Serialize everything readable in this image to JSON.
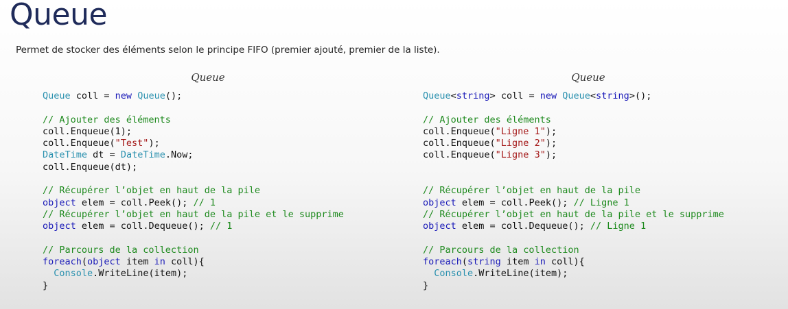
{
  "slide": {
    "title": "Queue",
    "description": "Permet de stocker des éléments selon le principe FIFO (premier ajouté, premier de la liste)."
  },
  "left_column": {
    "heading": "Queue",
    "lines": [
      [
        {
          "t": "ty",
          "v": "Queue"
        },
        {
          "t": "pl",
          "v": " coll = "
        },
        {
          "t": "kw",
          "v": "new"
        },
        {
          "t": "pl",
          "v": " "
        },
        {
          "t": "ty",
          "v": "Queue"
        },
        {
          "t": "pl",
          "v": "();"
        }
      ],
      [],
      [
        {
          "t": "cm",
          "v": "// Ajouter des éléments"
        }
      ],
      [
        {
          "t": "pl",
          "v": "coll.Enqueue(1);"
        }
      ],
      [
        {
          "t": "pl",
          "v": "coll.Enqueue("
        },
        {
          "t": "st",
          "v": "\"Test\""
        },
        {
          "t": "pl",
          "v": ");"
        }
      ],
      [
        {
          "t": "ty",
          "v": "DateTime"
        },
        {
          "t": "pl",
          "v": " dt = "
        },
        {
          "t": "ty",
          "v": "DateTime"
        },
        {
          "t": "pl",
          "v": ".Now;"
        }
      ],
      [
        {
          "t": "pl",
          "v": "coll.Enqueue(dt);"
        }
      ],
      [],
      [
        {
          "t": "cm",
          "v": "// Récupérer l’objet en haut de la pile"
        }
      ],
      [
        {
          "t": "kw",
          "v": "object"
        },
        {
          "t": "pl",
          "v": " elem = coll.Peek(); "
        },
        {
          "t": "cm",
          "v": "// 1"
        }
      ],
      [
        {
          "t": "cm",
          "v": "// Récupérer l’objet en haut de la pile et le supprime"
        }
      ],
      [
        {
          "t": "kw",
          "v": "object"
        },
        {
          "t": "pl",
          "v": " elem = coll.Dequeue(); "
        },
        {
          "t": "cm",
          "v": "// 1"
        }
      ],
      [],
      [
        {
          "t": "cm",
          "v": "// Parcours de la collection"
        }
      ],
      [
        {
          "t": "kw",
          "v": "foreach"
        },
        {
          "t": "pl",
          "v": "("
        },
        {
          "t": "kw",
          "v": "object"
        },
        {
          "t": "pl",
          "v": " item "
        },
        {
          "t": "kw",
          "v": "in"
        },
        {
          "t": "pl",
          "v": " coll){"
        }
      ],
      [
        {
          "t": "pl",
          "v": "  "
        },
        {
          "t": "ty",
          "v": "Console"
        },
        {
          "t": "pl",
          "v": ".WriteLine(item);"
        }
      ],
      [
        {
          "t": "pl",
          "v": "}"
        }
      ]
    ]
  },
  "right_column": {
    "heading": "Queue",
    "lines": [
      [
        {
          "t": "ty",
          "v": "Queue"
        },
        {
          "t": "pl",
          "v": "<"
        },
        {
          "t": "kw",
          "v": "string"
        },
        {
          "t": "pl",
          "v": "> coll = "
        },
        {
          "t": "kw",
          "v": "new"
        },
        {
          "t": "pl",
          "v": " "
        },
        {
          "t": "ty",
          "v": "Queue"
        },
        {
          "t": "pl",
          "v": "<"
        },
        {
          "t": "kw",
          "v": "string"
        },
        {
          "t": "pl",
          "v": ">();"
        }
      ],
      [],
      [
        {
          "t": "cm",
          "v": "// Ajouter des éléments"
        }
      ],
      [
        {
          "t": "pl",
          "v": "coll.Enqueue("
        },
        {
          "t": "st",
          "v": "\"Ligne 1\""
        },
        {
          "t": "pl",
          "v": ");"
        }
      ],
      [
        {
          "t": "pl",
          "v": "coll.Enqueue("
        },
        {
          "t": "st",
          "v": "\"Ligne 2\""
        },
        {
          "t": "pl",
          "v": ");"
        }
      ],
      [
        {
          "t": "pl",
          "v": "coll.Enqueue("
        },
        {
          "t": "st",
          "v": "\"Ligne 3\""
        },
        {
          "t": "pl",
          "v": ");"
        }
      ],
      [],
      [],
      [
        {
          "t": "cm",
          "v": "// Récupérer l’objet en haut de la pile"
        }
      ],
      [
        {
          "t": "kw",
          "v": "object"
        },
        {
          "t": "pl",
          "v": " elem = coll.Peek(); "
        },
        {
          "t": "cm",
          "v": "// Ligne 1"
        }
      ],
      [
        {
          "t": "cm",
          "v": "// Récupérer l’objet en haut de la pile et le supprime"
        }
      ],
      [
        {
          "t": "kw",
          "v": "object"
        },
        {
          "t": "pl",
          "v": " elem = coll.Dequeue(); "
        },
        {
          "t": "cm",
          "v": "// Ligne 1"
        }
      ],
      [],
      [
        {
          "t": "cm",
          "v": "// Parcours de la collection"
        }
      ],
      [
        {
          "t": "kw",
          "v": "foreach"
        },
        {
          "t": "pl",
          "v": "("
        },
        {
          "t": "kw",
          "v": "string"
        },
        {
          "t": "pl",
          "v": " item "
        },
        {
          "t": "kw",
          "v": "in"
        },
        {
          "t": "pl",
          "v": " coll){"
        }
      ],
      [
        {
          "t": "pl",
          "v": "  "
        },
        {
          "t": "ty",
          "v": "Console"
        },
        {
          "t": "pl",
          "v": ".WriteLine(item);"
        }
      ],
      [
        {
          "t": "pl",
          "v": "}"
        }
      ]
    ]
  }
}
